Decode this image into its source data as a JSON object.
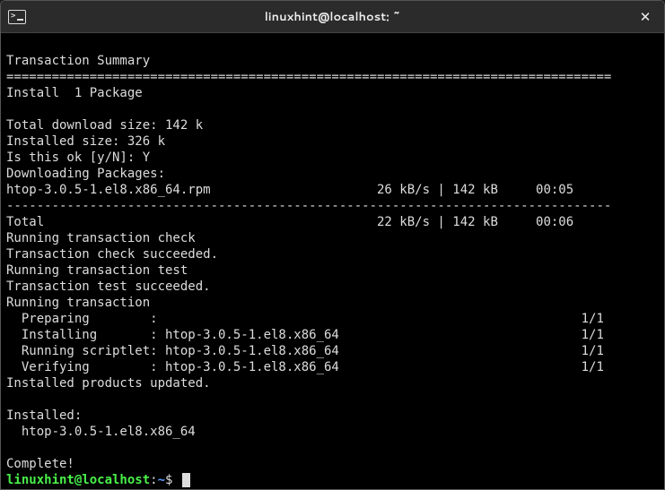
{
  "window": {
    "title": "linuxhint@localhost: ~"
  },
  "lines": {
    "l00": "",
    "l01": "Transaction Summary",
    "l02": "================================================================================",
    "l03": "Install  1 Package",
    "l04": "",
    "l05": "Total download size: 142 k",
    "l06": "Installed size: 326 k",
    "l07": "Is this ok [y/N]: Y",
    "l08": "Downloading Packages:",
    "l09": "htop-3.0.5-1.el8.x86_64.rpm                      26 kB/s | 142 kB     00:05    ",
    "l10": "--------------------------------------------------------------------------------",
    "l11": "Total                                            22 kB/s | 142 kB     00:06     ",
    "l12": "Running transaction check",
    "l13": "Transaction check succeeded.",
    "l14": "Running transaction test",
    "l15": "Transaction test succeeded.",
    "l16": "Running transaction",
    "l17": "  Preparing        :                                                        1/1 ",
    "l18": "  Installing       : htop-3.0.5-1.el8.x86_64                                1/1 ",
    "l19": "  Running scriptlet: htop-3.0.5-1.el8.x86_64                                1/1 ",
    "l20": "  Verifying        : htop-3.0.5-1.el8.x86_64                                1/1 ",
    "l21": "Installed products updated.",
    "l22": "",
    "l23": "Installed:",
    "l24": "  htop-3.0.5-1.el8.x86_64                                                       ",
    "l25": "",
    "l26": "Complete!"
  },
  "prompt": {
    "user_host": "linuxhint@localhost",
    "colon": ":",
    "path": "~",
    "dollar": "$ "
  }
}
